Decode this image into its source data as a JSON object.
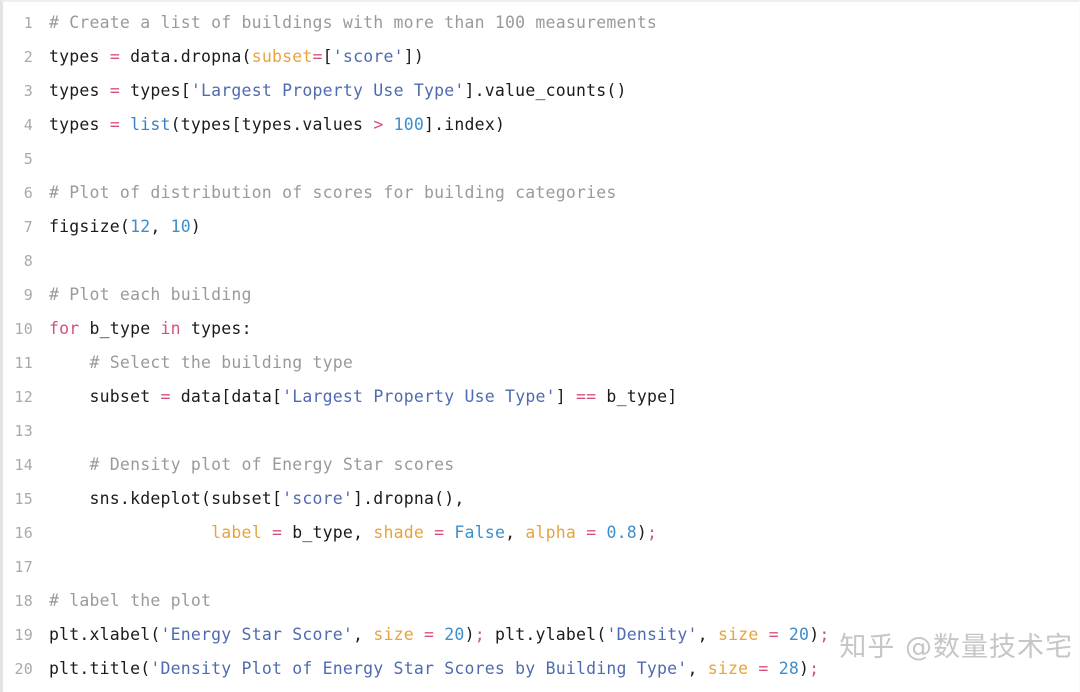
{
  "editor": {
    "language": "python",
    "first_line_number": 1,
    "line_count": 20,
    "colors": {
      "background": "#ffffff",
      "text": "#1b1b1b",
      "gutter": "#a9a9a9",
      "comment": "#9a9a9a",
      "string": "#4f6bb0",
      "number": "#3d8ecc",
      "keyword": "#d4517a",
      "operator": "#d4517a",
      "builtin": "#3b7fc4",
      "kwarg": "#e8a33d",
      "constant": "#3d8ecc",
      "cell_border": "#e3e3e3"
    }
  },
  "lines": [
    {
      "n": "1",
      "text": "# Create a list of buildings with more than 100 measurements"
    },
    {
      "n": "2",
      "text": "types = data.dropna(subset=['score'])"
    },
    {
      "n": "3",
      "text": "types = types['Largest Property Use Type'].value_counts()"
    },
    {
      "n": "4",
      "text": "types = list(types[types.values > 100].index)"
    },
    {
      "n": "5",
      "text": ""
    },
    {
      "n": "6",
      "text": "# Plot of distribution of scores for building categories"
    },
    {
      "n": "7",
      "text": "figsize(12, 10)"
    },
    {
      "n": "8",
      "text": ""
    },
    {
      "n": "9",
      "text": "# Plot each building"
    },
    {
      "n": "10",
      "text": "for b_type in types:"
    },
    {
      "n": "11",
      "text": "    # Select the building type"
    },
    {
      "n": "12",
      "text": "    subset = data[data['Largest Property Use Type'] == b_type]"
    },
    {
      "n": "13",
      "text": ""
    },
    {
      "n": "14",
      "text": "    # Density plot of Energy Star scores"
    },
    {
      "n": "15",
      "text": "    sns.kdeplot(subset['score'].dropna(),"
    },
    {
      "n": "16",
      "text": "                label = b_type, shade = False, alpha = 0.8);"
    },
    {
      "n": "17",
      "text": ""
    },
    {
      "n": "18",
      "text": "# label the plot"
    },
    {
      "n": "19",
      "text": "plt.xlabel('Energy Star Score', size = 20); plt.ylabel('Density', size = 20);"
    },
    {
      "n": "20",
      "text": "plt.title('Density Plot of Energy Star Scores by Building Type', size = 28);"
    }
  ],
  "watermark": {
    "text": "知乎 @数量技术宅"
  }
}
